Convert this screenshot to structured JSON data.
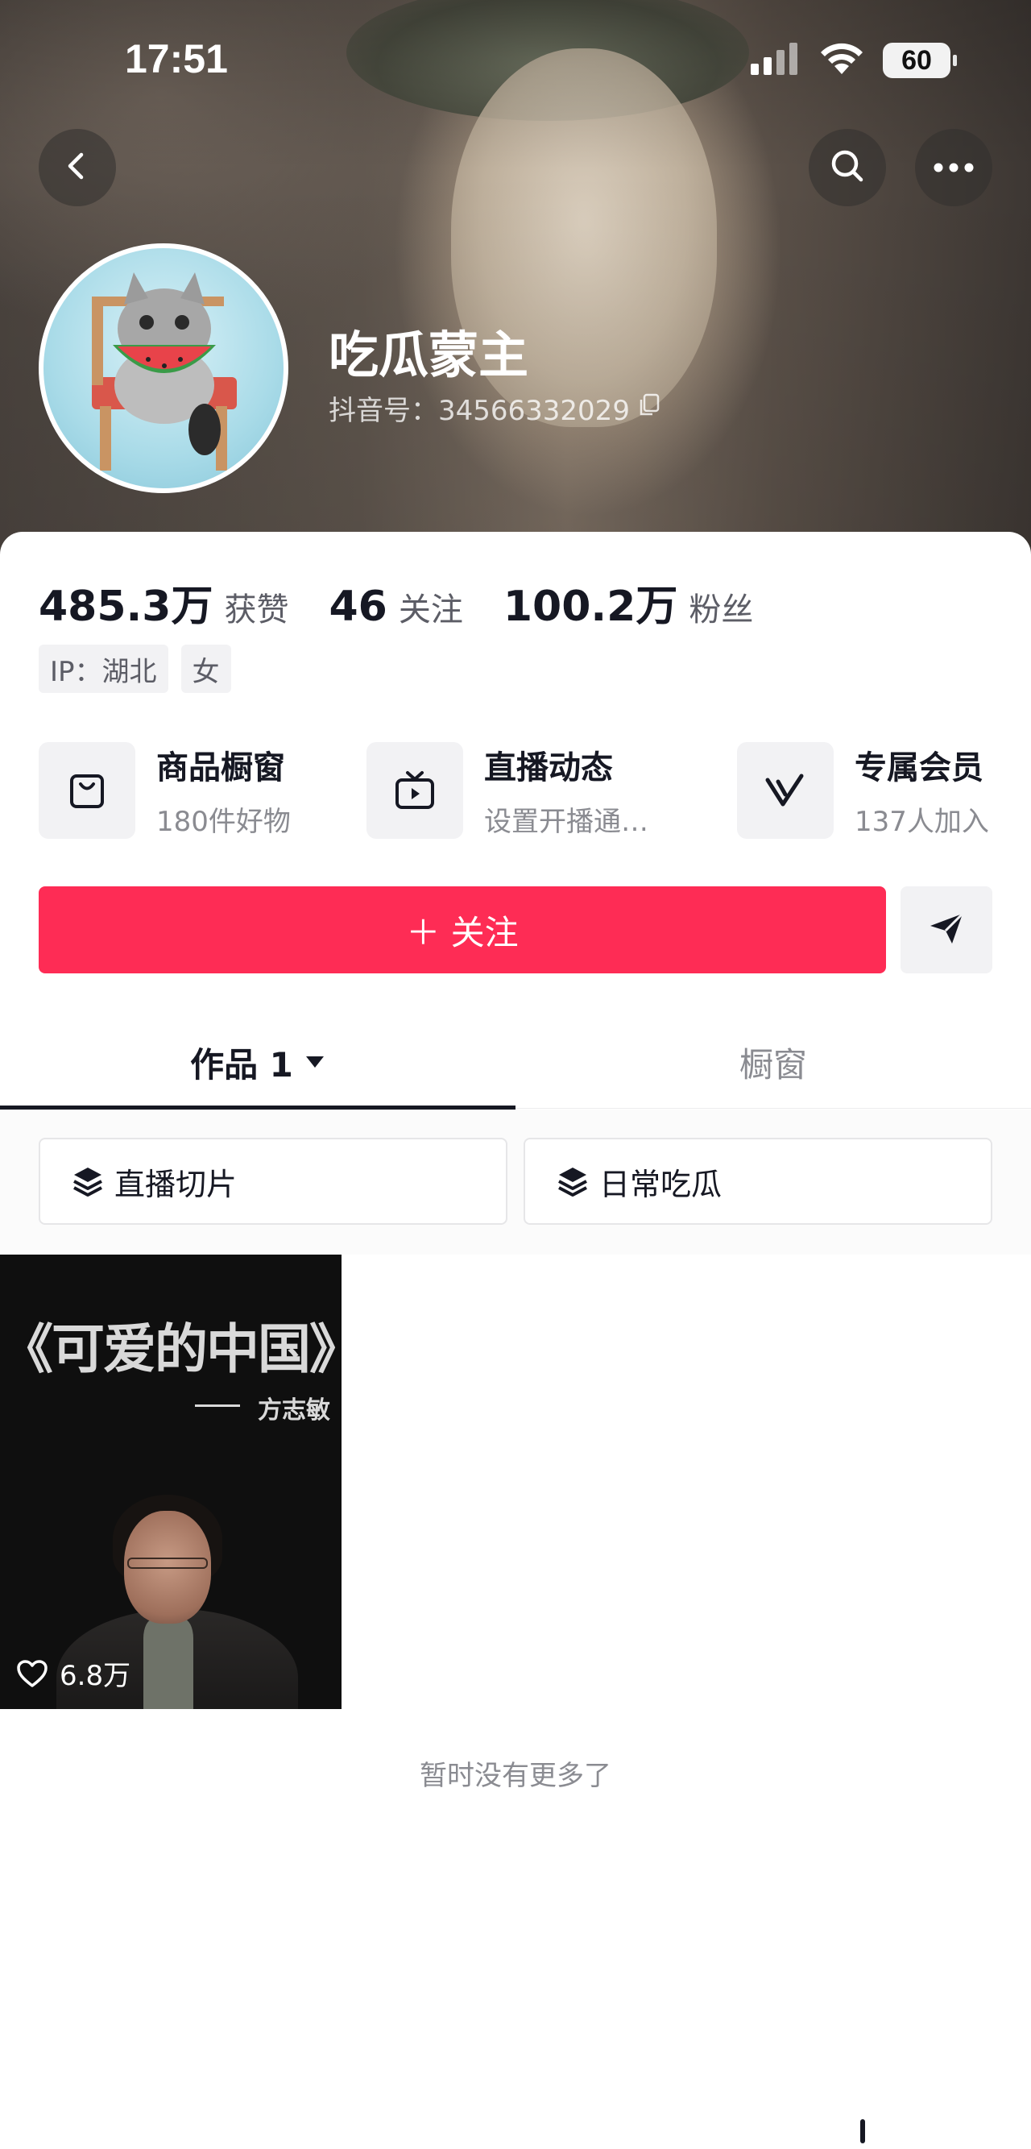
{
  "status_bar": {
    "time": "17:51",
    "battery": "60"
  },
  "profile": {
    "name": "吃瓜蒙主",
    "douyin_id": "抖音号：34566332029"
  },
  "stats": [
    {
      "value": "485.3万",
      "label": "获赞"
    },
    {
      "value": "46",
      "label": "关注"
    },
    {
      "value": "100.2万",
      "label": "粉丝"
    }
  ],
  "tags": [
    "IP：湖北",
    "女"
  ],
  "features": [
    {
      "title": "商品橱窗",
      "subtitle": "180件好物",
      "icon": "shopping-bag-icon"
    },
    {
      "title": "直播动态",
      "subtitle": "设置开播通…",
      "icon": "tv-icon"
    },
    {
      "title": "专属会员",
      "subtitle": "137人加入",
      "icon": "v-badge-icon"
    }
  ],
  "follow_button": "＋ 关注",
  "tabs": {
    "works": "作品 1",
    "window": "橱窗"
  },
  "chips": [
    "直播切片",
    "日常吃瓜"
  ],
  "video": {
    "title": "《可爱的中国》",
    "author": "方志敏",
    "likes": "6.8万"
  },
  "footer": {
    "no_more": "暂时没有更多了"
  },
  "colors": {
    "follow_button": "#fe2c55",
    "text_primary": "#161823",
    "text_secondary": "#8a8b91"
  }
}
